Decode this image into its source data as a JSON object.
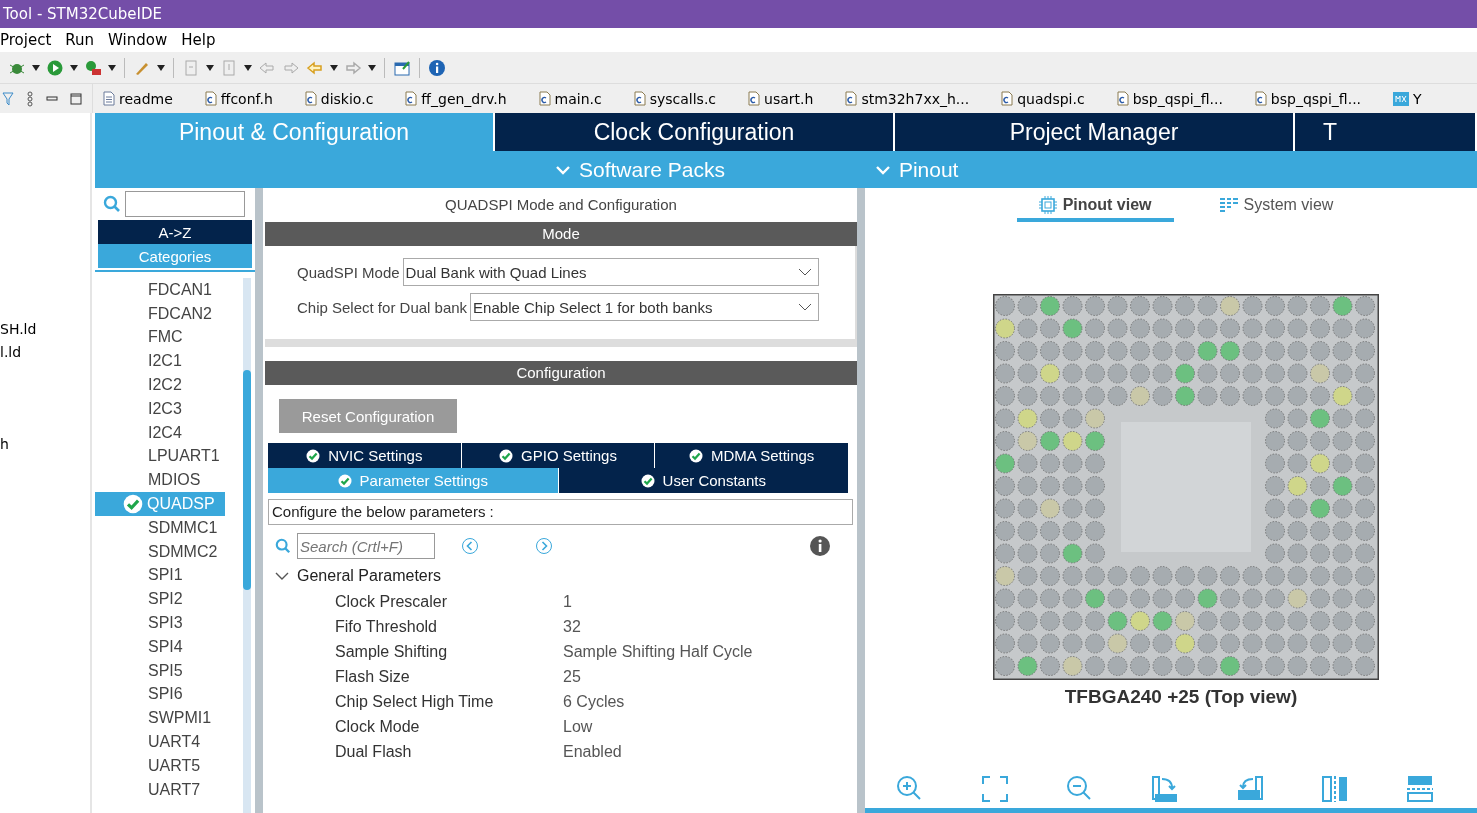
{
  "window": {
    "title": "Tool - STM32CubeIDE"
  },
  "menu": [
    "Project",
    "Run",
    "Window",
    "Help"
  ],
  "editor_tabs": [
    {
      "label": "readme",
      "kind": "text"
    },
    {
      "label": "ffconf.h",
      "kind": "c"
    },
    {
      "label": "diskio.c",
      "kind": "c"
    },
    {
      "label": "ff_gen_drv.h",
      "kind": "c"
    },
    {
      "label": "main.c",
      "kind": "c"
    },
    {
      "label": "syscalls.c",
      "kind": "c"
    },
    {
      "label": "usart.h",
      "kind": "c"
    },
    {
      "label": "stm32h7xx_h...",
      "kind": "c"
    },
    {
      "label": "quadspi.c",
      "kind": "c"
    },
    {
      "label": "bsp_qspi_fl...",
      "kind": "c"
    },
    {
      "label": "bsp_qspi_fl...",
      "kind": "c"
    },
    {
      "label": "Y",
      "kind": "mx"
    }
  ],
  "left_panel": {
    "items": [
      "SH.ld",
      "l.ld",
      "h"
    ]
  },
  "perspective_tabs": [
    {
      "label": "Pinout & Configuration",
      "selected": true
    },
    {
      "label": "Clock Configuration",
      "selected": false
    },
    {
      "label": "Project Manager",
      "selected": false
    },
    {
      "label": "T",
      "selected": false
    }
  ],
  "sub_menu": [
    "Software Packs",
    "Pinout"
  ],
  "categories": {
    "sort_tabs": [
      {
        "label": "A->Z",
        "selected": false
      },
      {
        "label": "Categories",
        "selected": true
      }
    ],
    "items": [
      {
        "label": "FDCAN1",
        "selected": false,
        "checked": false
      },
      {
        "label": "FDCAN2",
        "selected": false,
        "checked": false
      },
      {
        "label": "FMC",
        "selected": false,
        "checked": false
      },
      {
        "label": "I2C1",
        "selected": false,
        "checked": false
      },
      {
        "label": "I2C2",
        "selected": false,
        "checked": false
      },
      {
        "label": "I2C3",
        "selected": false,
        "checked": false
      },
      {
        "label": "I2C4",
        "selected": false,
        "checked": false
      },
      {
        "label": "LPUART1",
        "selected": false,
        "checked": false
      },
      {
        "label": "MDIOS",
        "selected": false,
        "checked": false
      },
      {
        "label": "QUADSP",
        "selected": true,
        "checked": true
      },
      {
        "label": "SDMMC1",
        "selected": false,
        "checked": false
      },
      {
        "label": "SDMMC2",
        "selected": false,
        "checked": false
      },
      {
        "label": "SPI1",
        "selected": false,
        "checked": false
      },
      {
        "label": "SPI2",
        "selected": false,
        "checked": false
      },
      {
        "label": "SPI3",
        "selected": false,
        "checked": false
      },
      {
        "label": "SPI4",
        "selected": false,
        "checked": false
      },
      {
        "label": "SPI5",
        "selected": false,
        "checked": false
      },
      {
        "label": "SPI6",
        "selected": false,
        "checked": false
      },
      {
        "label": "SWPMI1",
        "selected": false,
        "checked": false
      },
      {
        "label": "UART4",
        "selected": false,
        "checked": false
      },
      {
        "label": "UART5",
        "selected": false,
        "checked": false
      },
      {
        "label": "UART7",
        "selected": false,
        "checked": false
      }
    ]
  },
  "mode_panel": {
    "title": "QUADSPI Mode and Configuration",
    "header": "Mode",
    "fields": [
      {
        "label": "QuadSPI Mode",
        "value": "Dual Bank with Quad Lines"
      },
      {
        "label": "Chip Select for Dual bank",
        "value": "Enable Chip Select 1 for both banks"
      }
    ]
  },
  "configuration": {
    "header": "Configuration",
    "reset_button": "Reset Configuration",
    "tab_rows": [
      [
        {
          "label": "NVIC Settings",
          "selected": false
        },
        {
          "label": "GPIO Settings",
          "selected": false
        },
        {
          "label": "MDMA Settings",
          "selected": false
        }
      ],
      [
        {
          "label": "Parameter Settings",
          "selected": true
        },
        {
          "label": "User Constants",
          "selected": false
        }
      ]
    ],
    "hint": "Configure the below parameters :",
    "search": {
      "placeholder": "Search (Crtl+F)"
    },
    "group": {
      "label": "General Parameters",
      "expanded": true,
      "params": [
        {
          "name": "Clock Prescaler",
          "value": "1"
        },
        {
          "name": "Fifo Threshold",
          "value": "32"
        },
        {
          "name": "Sample Shifting",
          "value": "Sample Shifting Half Cycle"
        },
        {
          "name": "Flash Size",
          "value": "25"
        },
        {
          "name": "Chip Select High Time",
          "value": "6 Cycles"
        },
        {
          "name": "Clock Mode",
          "value": "Low"
        },
        {
          "name": "Dual Flash",
          "value": "Enabled"
        }
      ]
    }
  },
  "pinout": {
    "view_tabs": [
      {
        "label": "Pinout view",
        "selected": true
      },
      {
        "label": "System view",
        "selected": false
      }
    ],
    "caption": "TFBGA240 +25 (Top view)"
  }
}
